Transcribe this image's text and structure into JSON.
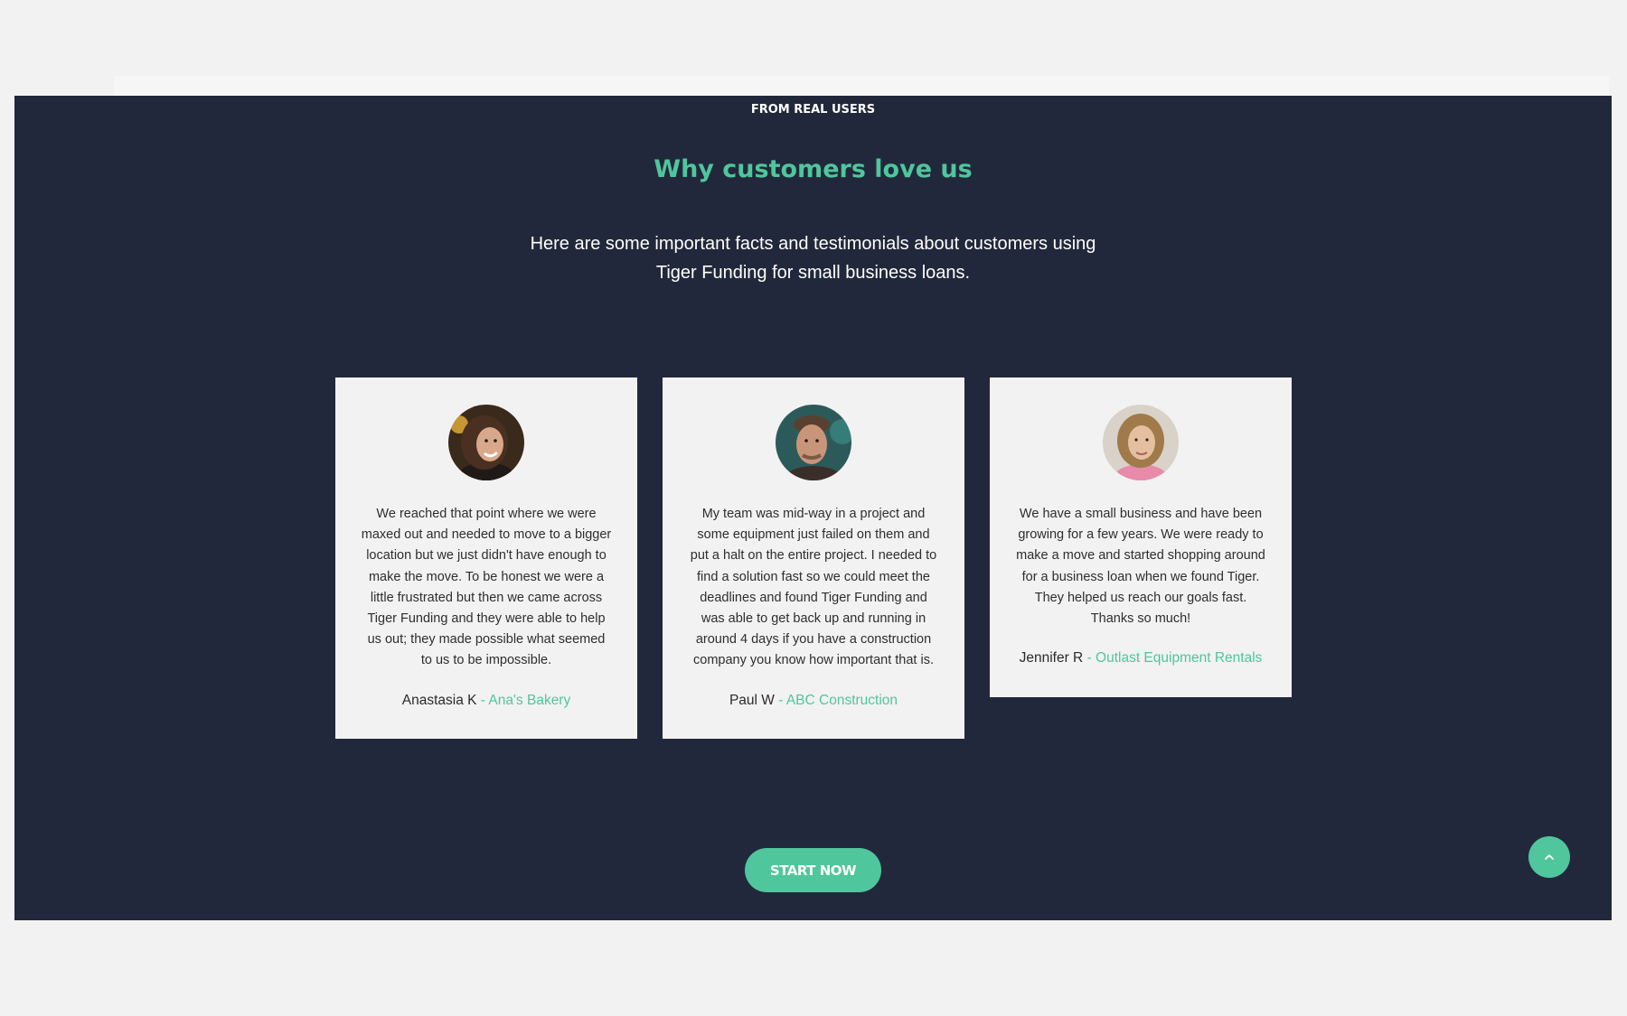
{
  "section": {
    "eyebrow": "FROM REAL USERS",
    "title": "Why customers love us",
    "subtitle": "Here are some important facts and testimonials about customers using Tiger Funding for small business loans."
  },
  "testimonials": [
    {
      "quote": "We reached that point where we were maxed out and needed to move to a bigger location but we just didn't have enough to make the move. To be honest we were a little frustrated but then we came across Tiger Funding and they were able to help us out; they made possible what seemed to us to be impossible.",
      "name": "Anastasia K",
      "company": " - Ana's Bakery"
    },
    {
      "quote": "My team was mid-way in a project and some equipment just failed on them and put a halt on the entire project. I needed to find a solution fast so we could meet the deadlines and found Tiger Funding and was able to get back up and running in around 4 days if you have a construction company you know how important that is.",
      "name": "Paul W",
      "company": " - ABC Construction"
    },
    {
      "quote": "We have a small business and have been growing for a few years. We were ready to make a move and started shopping around for a  business loan when we found Tiger. They helped us reach our goals fast. Thanks so much!",
      "name": "Jennifer R",
      "company": " - Outlast Equipment Rentals"
    }
  ],
  "cta": {
    "label": "START NOW"
  },
  "colors": {
    "accent": "#4fc69c",
    "section_bg": "#22283b",
    "card_bg": "#f2f2f2",
    "page_bg": "#f2f2f2"
  },
  "icons": {
    "scroll_top": "chevron-up-icon"
  }
}
